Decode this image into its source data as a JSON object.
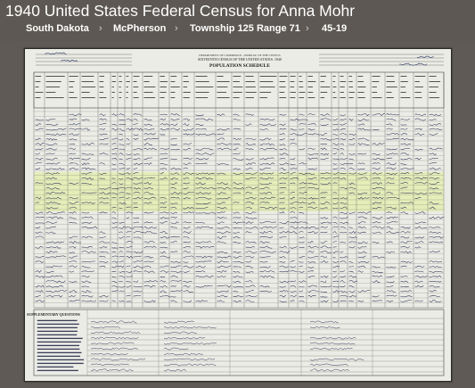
{
  "page": {
    "title": "1940 United States Federal Census for Anna Mohr"
  },
  "breadcrumb": {
    "items": [
      {
        "label": "South Dakota"
      },
      {
        "label": "McPherson"
      },
      {
        "label": "Township 125 Range 71"
      },
      {
        "label": "45-19"
      }
    ],
    "separator": "›"
  },
  "document": {
    "heading_lines": [
      "DEPARTMENT OF COMMERCE—BUREAU OF THE CENSUS",
      "SIXTEENTH CENSUS OF THE UNITED STATES: 1940",
      "POPULATION SCHEDULE"
    ],
    "supplementary_label": "SUPPLEMENTARY QUESTIONS",
    "highlight_color": "#e4edb0",
    "sheet_color": "#ecece6"
  }
}
